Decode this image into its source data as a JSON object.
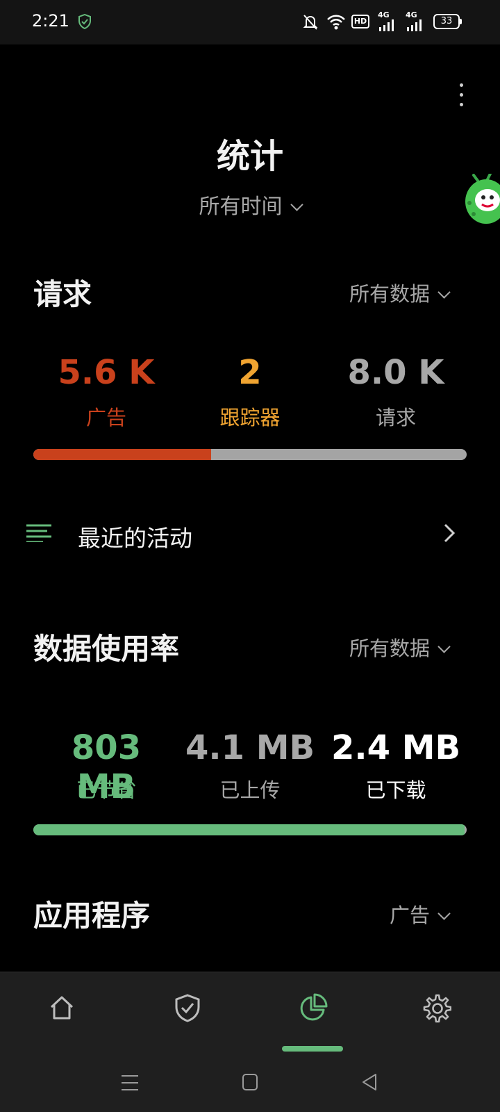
{
  "status_bar": {
    "time": "2:21",
    "network_a": "4G",
    "network_b": "4G",
    "battery": "33"
  },
  "header": {
    "title": "统计",
    "time_range": "所有时间"
  },
  "requests": {
    "title": "请求",
    "filter": "所有数据",
    "stats": [
      {
        "value": "5.6 K",
        "label": "广告",
        "color": "#c9411c"
      },
      {
        "value": "2",
        "label": "跟踪器",
        "color": "#f0a431"
      },
      {
        "value": "8.0 K",
        "label": "请求",
        "color": "#a8a8a8"
      }
    ],
    "progress_fraction": 0.41,
    "progress_color": "#c9411c"
  },
  "recent_activity": {
    "label": "最近的活动"
  },
  "data_usage": {
    "title": "数据使用率",
    "filter": "所有数据",
    "stats": [
      {
        "value": "803 MB",
        "label": "已节省",
        "color": "#66bb7c"
      },
      {
        "value": "4.1 MB",
        "label": "已上传",
        "color": "#a8a8a8"
      },
      {
        "value": "2.4 MB",
        "label": "已下载",
        "color": "#ffffff"
      }
    ],
    "progress_fraction": 0.995,
    "progress_color": "#66bb7c"
  },
  "apps": {
    "title": "应用程序",
    "filter": "广告"
  },
  "bottom_nav": {
    "items": [
      {
        "icon": "home-icon"
      },
      {
        "icon": "shield-check-icon"
      },
      {
        "icon": "pie-chart-icon",
        "selected": true
      },
      {
        "icon": "gear-icon"
      }
    ],
    "accent": "#66bb7c"
  }
}
